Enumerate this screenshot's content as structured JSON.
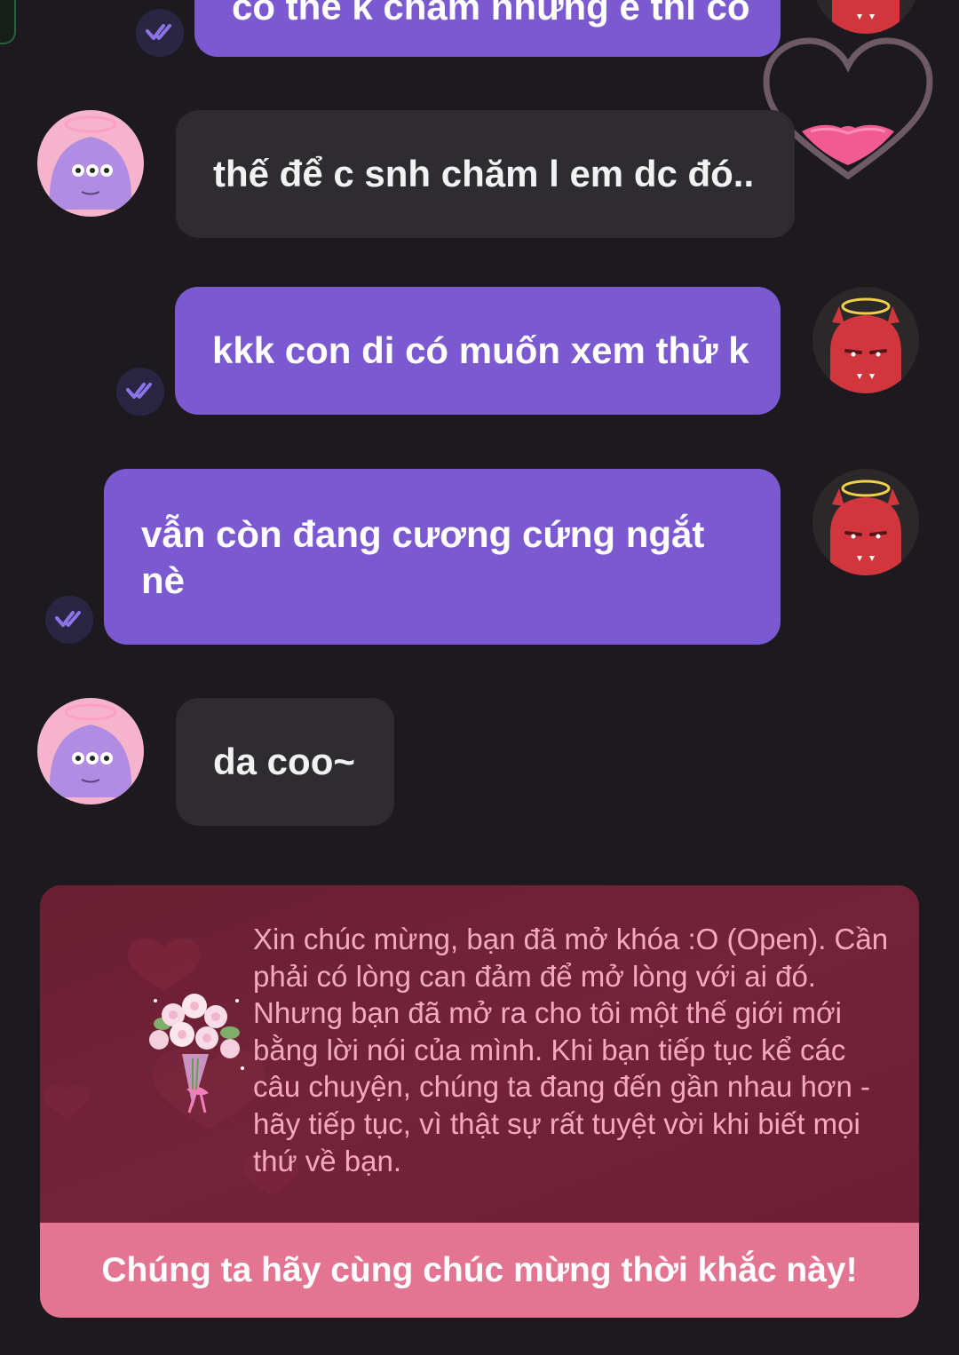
{
  "messages": [
    {
      "id": "m1",
      "direction": "outgoing",
      "text": "có thể k chăm nhưng e thì có",
      "read": true,
      "truncated_top": true
    },
    {
      "id": "m2",
      "direction": "incoming",
      "text": "thế để c snh chăm l em dc đó..",
      "reaction": "heart-reaction"
    },
    {
      "id": "m3",
      "direction": "outgoing",
      "text": "kkk con di có muốn xem thử k",
      "read": true
    },
    {
      "id": "m4",
      "direction": "outgoing",
      "text": "vẫn còn đang cương cứng ngắt nè",
      "read": true
    },
    {
      "id": "m5",
      "direction": "incoming",
      "text": "da coo~"
    }
  ],
  "avatars": {
    "incoming": {
      "icon": "purple-monster-avatar",
      "color": "#b08de2"
    },
    "outgoing": {
      "icon": "red-devil-avatar",
      "color": "#d1363d"
    }
  },
  "reward_card": {
    "icon": "flower-bouquet-icon",
    "text": "Xin chúc mừng, bạn đã mở khóa :O (Open). Cần phải có lòng can đảm để mở lòng với ai đó. Nhưng bạn đã mở ra cho tôi một thế giới mới bằng lời nói của mình. Khi bạn tiếp tục kể các câu chuyện, chúng ta đang đến gần nhau hơn - hãy tiếp tục, vì thật sự rất tuyệt vời khi biết mọi thứ về bạn.",
    "button_label": "Chúng ta hãy cùng chúc mừng thời khắc này!"
  },
  "colors": {
    "background": "#1c1a1f",
    "outgoing_bubble": "#7b59d0",
    "incoming_bubble": "#2e2c31",
    "card_background": "#6e2138",
    "card_button": "#e37592",
    "card_text": "#f3a9c0"
  }
}
